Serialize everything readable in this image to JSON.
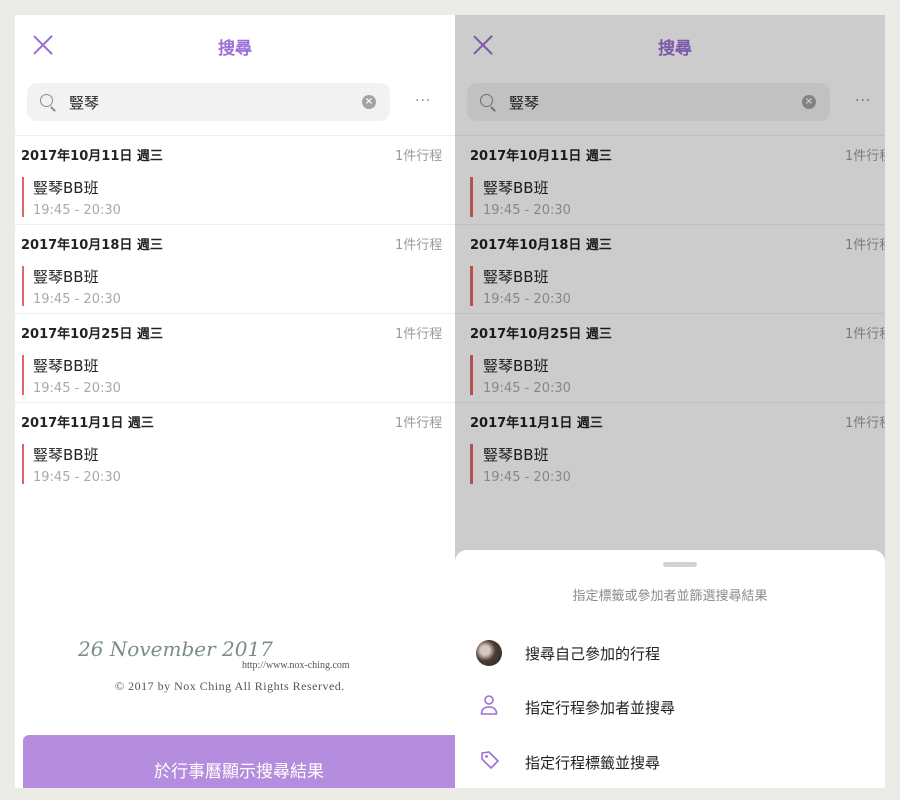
{
  "header": {
    "title": "搜尋",
    "close_icon": "close-icon"
  },
  "search": {
    "value": "豎琴",
    "clear_icon": "clear-icon",
    "more_icon": "more-horizontal-icon",
    "more_label": "···"
  },
  "results": [
    {
      "date": "2017年10月11日 週三",
      "count": "1件行程",
      "event": {
        "title": "豎琴BB班",
        "time": "19:45 - 20:30"
      }
    },
    {
      "date": "2017年10月18日 週三",
      "count": "1件行程",
      "event": {
        "title": "豎琴BB班",
        "time": "19:45 - 20:30"
      }
    },
    {
      "date": "2017年10月25日 週三",
      "count": "1件行程",
      "event": {
        "title": "豎琴BB班",
        "time": "19:45 - 20:30"
      }
    },
    {
      "date": "2017年11月1日 週三",
      "count": "1件行程",
      "event": {
        "title": "豎琴BB班",
        "time": "19:45 - 20:30"
      }
    }
  ],
  "watermark": {
    "date": "26 November 2017",
    "url": "http://www.nox-ching.com",
    "copyright": "© 2017 by Nox Ching All Rights Reserved."
  },
  "bottom_button": {
    "label": "於行事曆顯示搜尋結果"
  },
  "filter_sheet": {
    "hint": "指定標籤或參加者並篩選搜尋結果",
    "items": [
      {
        "label": "搜尋自己參加的行程",
        "icon": "avatar"
      },
      {
        "label": "指定行程參加者並搜尋",
        "icon": "person-icon"
      },
      {
        "label": "指定行程標籤並搜尋",
        "icon": "tag-icon"
      }
    ]
  },
  "colors": {
    "accent": "#9b6fd6",
    "button": "#b58ddf",
    "event_bar": "#e06565"
  }
}
